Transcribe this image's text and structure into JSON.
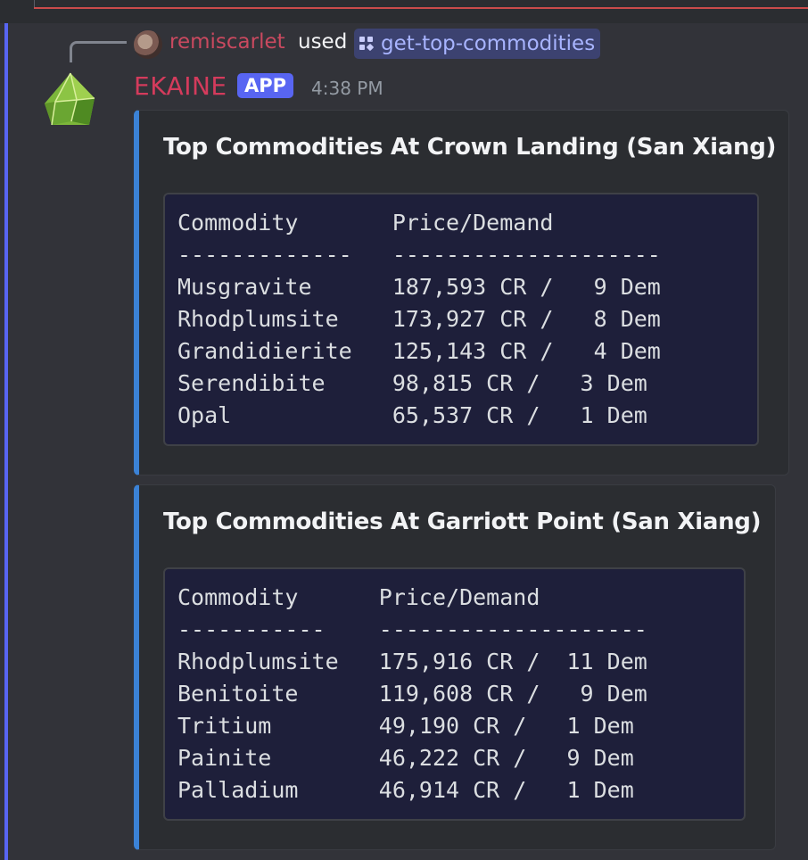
{
  "reply": {
    "user": "remiscarlet",
    "used_text": "used",
    "command": "get-top-commodities"
  },
  "message": {
    "author": "EKAINE",
    "badge": "APP",
    "timestamp": "4:38 PM"
  },
  "embeds": [
    {
      "title": "Top Commodities At Crown Landing (San Xiang)",
      "lines": [
        "Commodity       Price/Demand",
        "-------------   --------------------",
        "Musgravite      187,593 CR /   9 Dem",
        "Rhodplumsite    173,927 CR /   8 Dem",
        "Grandidierite   125,143 CR /   4 Dem",
        "Serendibite     98,815 CR /   3 Dem",
        "Opal            65,537 CR /   1 Dem"
      ]
    },
    {
      "title": "Top Commodities At Garriott Point (San Xiang)",
      "lines": [
        "Commodity      Price/Demand",
        "-----------    --------------------",
        "Rhodplumsite   175,916 CR /  11 Dem",
        "Benitoite      119,608 CR /   9 Dem",
        "Tritium        49,190 CR /   1 Dem",
        "Painite        46,222 CR /   9 Dem",
        "Palladium      46,914 CR /   1 Dem"
      ]
    }
  ],
  "colors": {
    "background": "#323339",
    "embed_background": "#2b2d31",
    "embed_accent": "#3b82d6",
    "author_color": "#d43b5c",
    "reply_user_color": "#c9495f",
    "badge_color": "#5865f2",
    "command_pill": "#3c4270",
    "command_text": "#a8b4ff"
  },
  "icons": {
    "bot_avatar": "green-crystal-icon",
    "reply_avatar": "user-avatar",
    "command": "slash-command-icon"
  }
}
